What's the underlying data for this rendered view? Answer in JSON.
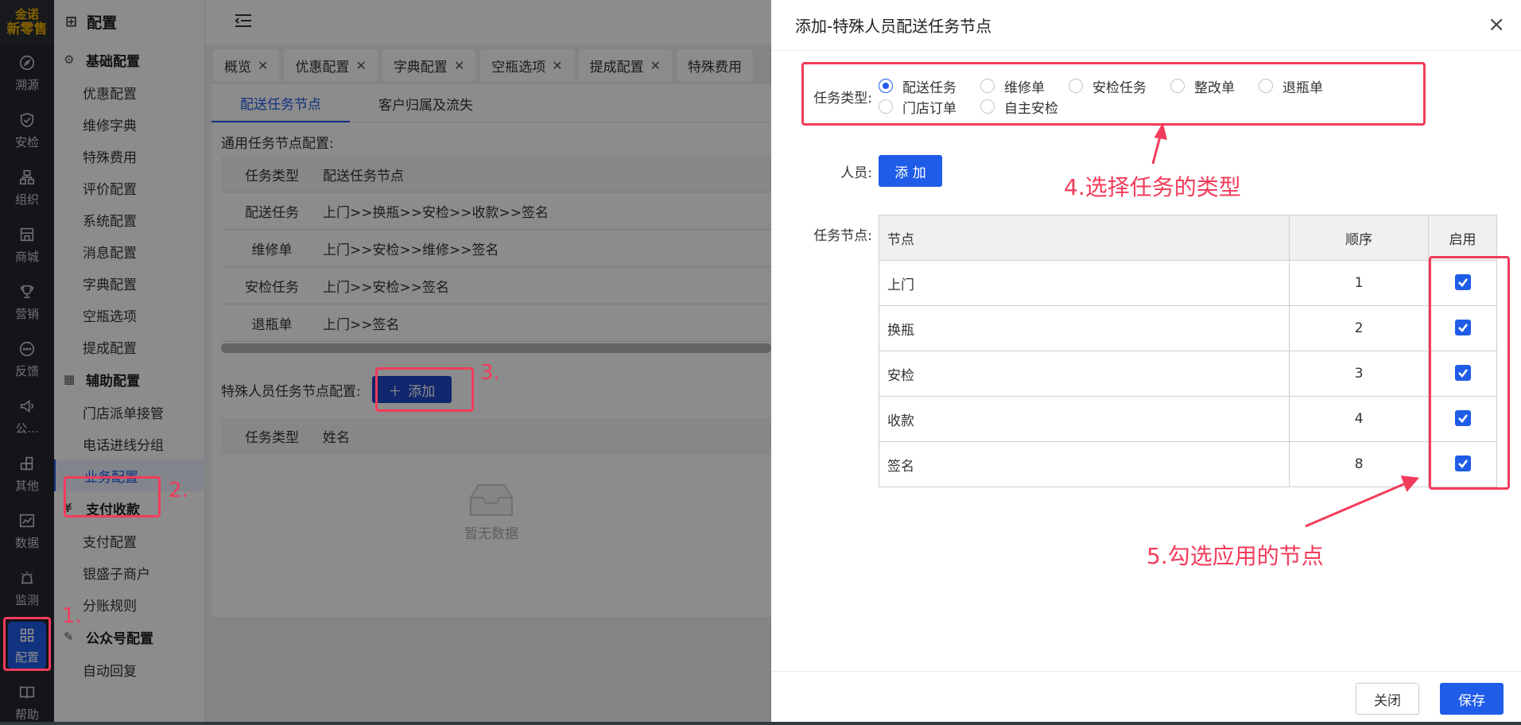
{
  "logo": {
    "line1": "金诺",
    "line2": "新零售"
  },
  "rail": [
    {
      "label": "溯源",
      "icon": "compass-icon"
    },
    {
      "label": "安检",
      "icon": "shield-icon"
    },
    {
      "label": "组织",
      "icon": "org-icon"
    },
    {
      "label": "商城",
      "icon": "store-icon"
    },
    {
      "label": "营销",
      "icon": "trophy-icon"
    },
    {
      "label": "反馈",
      "icon": "chat-icon"
    },
    {
      "label": "公...",
      "icon": "megaphone-icon"
    },
    {
      "label": "其他",
      "icon": "blocks-icon"
    },
    {
      "label": "数据",
      "icon": "chart-icon"
    },
    {
      "label": "监测",
      "icon": "alarm-icon"
    },
    {
      "label": "配置",
      "icon": "grid-icon",
      "active": true
    },
    {
      "label": "帮助",
      "icon": "book-icon"
    }
  ],
  "menu": {
    "title": "配置",
    "groups": [
      {
        "title": "基础配置",
        "items": [
          "优惠配置",
          "维修字典",
          "特殊费用",
          "评价配置",
          "系统配置",
          "消息配置",
          "字典配置",
          "空瓶选项",
          "提成配置"
        ]
      },
      {
        "title": "辅助配置",
        "items": [
          "门店派单接管",
          "电话进线分组",
          "业务配置"
        ]
      },
      {
        "title": "支付收款",
        "items": [
          "支付配置",
          "银盛子商户",
          "分账规则"
        ]
      },
      {
        "title": "公众号配置",
        "items": [
          "自动回复"
        ]
      }
    ]
  },
  "tabs": [
    "概览",
    "优惠配置",
    "字典配置",
    "空瓶选项",
    "提成配置",
    "特殊费用"
  ],
  "subtabs": [
    "配送任务节点",
    "客户归属及流失"
  ],
  "common_section": {
    "label": "通用任务节点配置:",
    "headers": [
      "任务类型",
      "配送任务节点"
    ],
    "rows": [
      [
        "配送任务",
        "上门>>换瓶>>安检>>收款>>签名"
      ],
      [
        "维修单",
        "上门>>安检>>维修>>签名"
      ],
      [
        "安检任务",
        "上门>>安检>>签名"
      ],
      [
        "退瓶单",
        "上门>>签名"
      ]
    ]
  },
  "special_section": {
    "label": "特殊人员任务节点配置:",
    "add_label": "添加",
    "headers": [
      "任务类型",
      "姓名"
    ],
    "empty": "暂无数据"
  },
  "drawer": {
    "title": "添加-特殊人员配送任务节点",
    "task_type_label": "任务类型:",
    "task_types": [
      "配送任务",
      "维修单",
      "安检任务",
      "整改单",
      "退瓶单",
      "门店订单",
      "自主安检"
    ],
    "selected_task_type": "配送任务",
    "person_label": "人员:",
    "person_add": "添 加",
    "nodes_label": "任务节点:",
    "node_headers": [
      "节点",
      "顺序",
      "启用"
    ],
    "nodes": [
      {
        "name": "上门",
        "order": "1",
        "enabled": true
      },
      {
        "name": "换瓶",
        "order": "2",
        "enabled": true
      },
      {
        "name": "安检",
        "order": "3",
        "enabled": true
      },
      {
        "name": "收款",
        "order": "4",
        "enabled": true
      },
      {
        "name": "签名",
        "order": "8",
        "enabled": true
      }
    ],
    "close": "关闭",
    "save": "保存"
  },
  "annotations": {
    "n1": "1.",
    "n2": "2.",
    "n3": "3.",
    "n4": "4.选择任务的类型",
    "n5": "5.勾选应用的节点",
    "color": "#f23c5b"
  }
}
